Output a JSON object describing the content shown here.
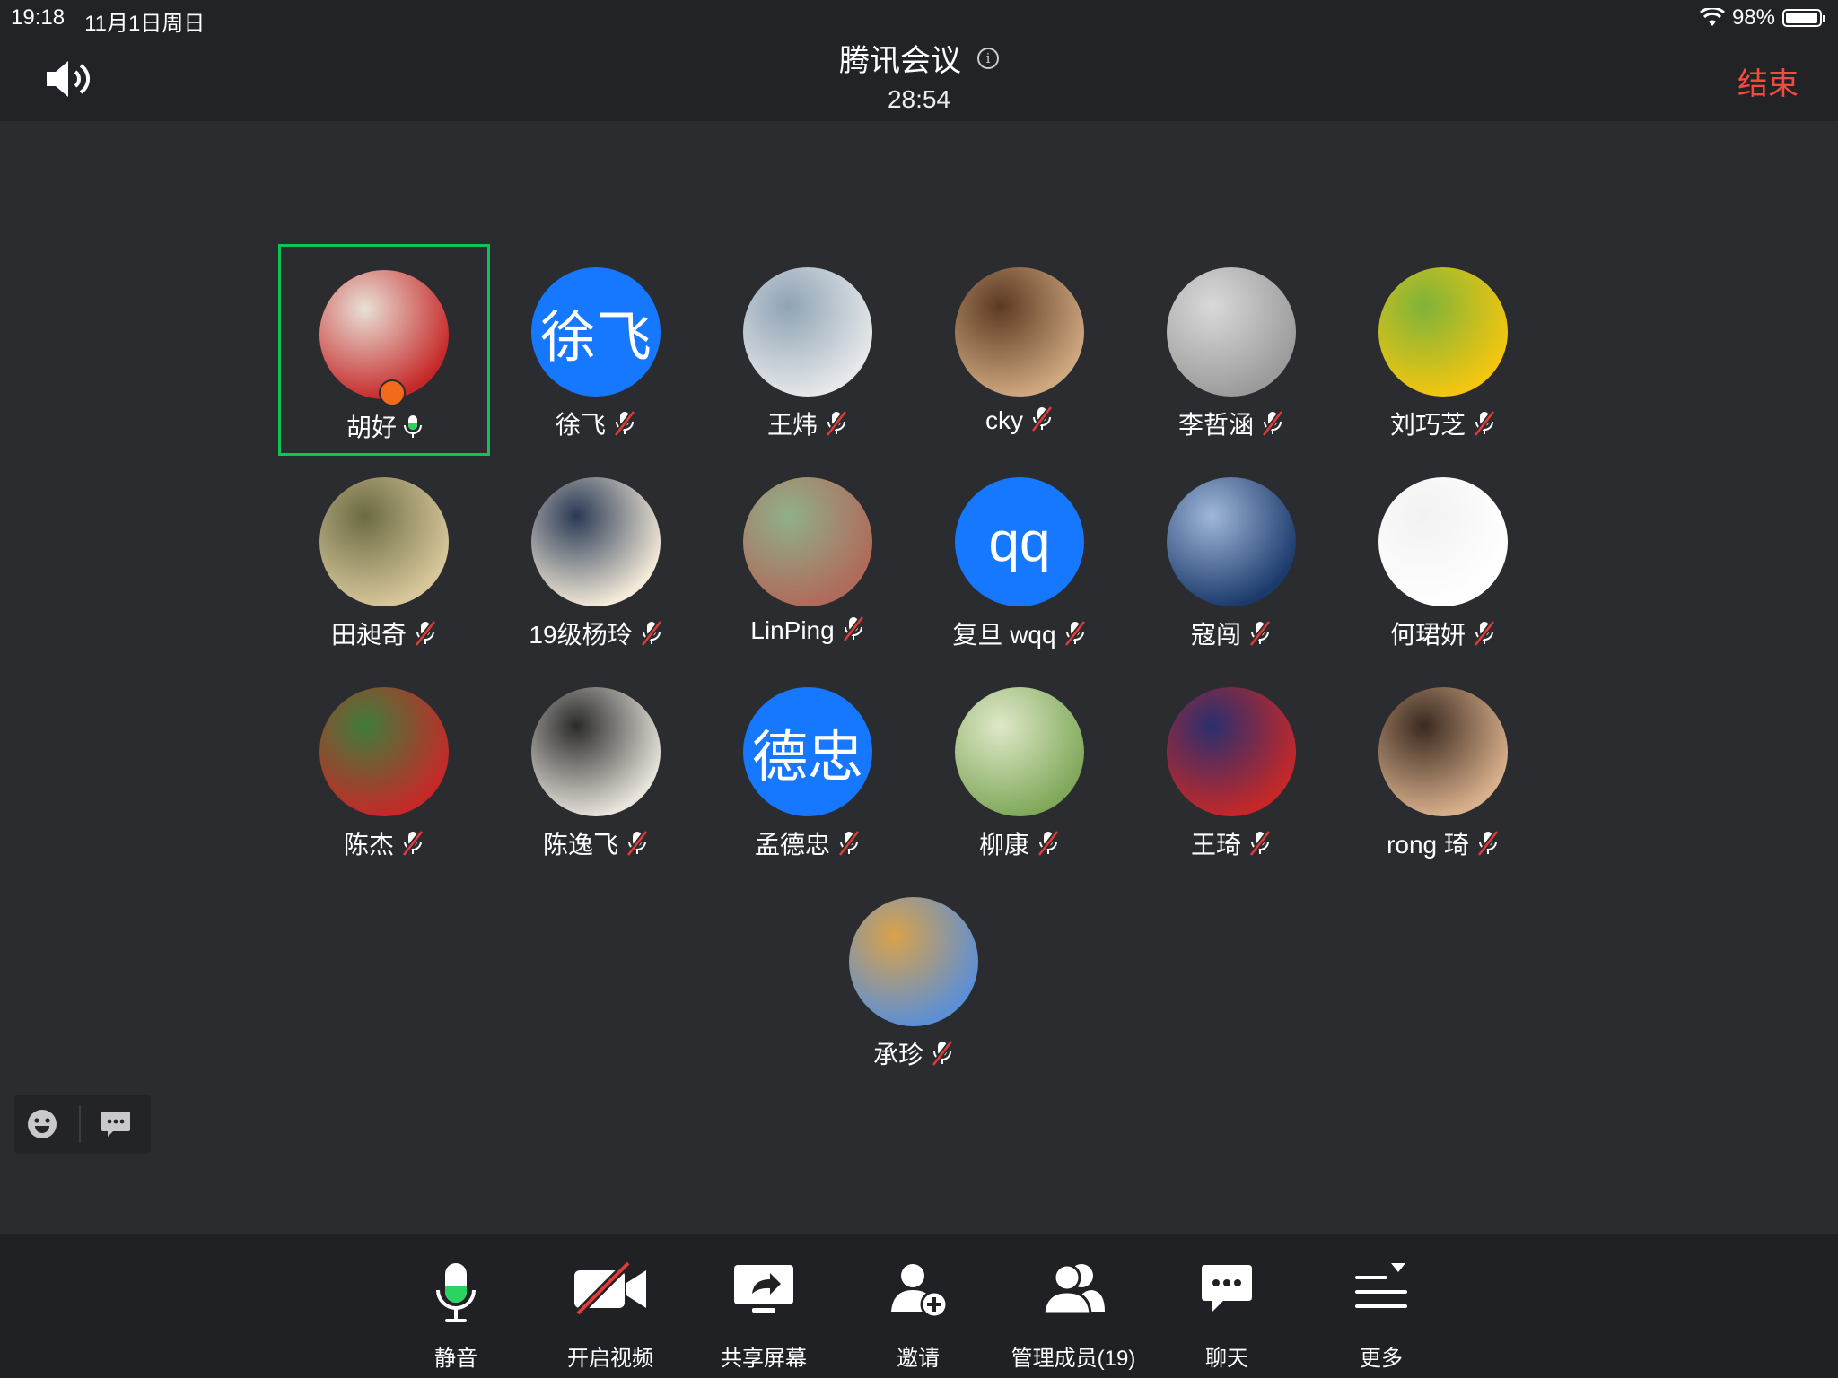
{
  "status_bar": {
    "time": "19:18",
    "date": "11月1日周日",
    "battery": "98%",
    "battery_level": 0.98
  },
  "header": {
    "title": "腾讯会议",
    "timer": "28:54",
    "end_label": "结束"
  },
  "participants": [
    {
      "name": "胡好",
      "mic": "on",
      "avatar": "photo",
      "host": true,
      "active": true,
      "colors": [
        "#c62828",
        "#e8e0d6"
      ]
    },
    {
      "name": "徐飞",
      "mic": "muted",
      "avatar": "text",
      "avatar_text": "徐飞"
    },
    {
      "name": "王炜",
      "mic": "muted",
      "avatar": "photo",
      "colors": [
        "#e6e8ea",
        "#8fa3b5"
      ]
    },
    {
      "name": "cky",
      "mic": "muted",
      "avatar": "photo",
      "colors": [
        "#cfa880",
        "#5c3a22"
      ]
    },
    {
      "name": "李哲涵",
      "mic": "muted",
      "avatar": "photo",
      "colors": [
        "#9b9b9b",
        "#d9d9d9"
      ]
    },
    {
      "name": "刘巧芝",
      "mic": "muted",
      "avatar": "photo",
      "colors": [
        "#f4c60f",
        "#7fb33a"
      ]
    },
    {
      "name": "田昶奇",
      "mic": "muted",
      "avatar": "photo",
      "colors": [
        "#d8c79a",
        "#6b6b45"
      ]
    },
    {
      "name": "19级杨玲",
      "mic": "muted",
      "avatar": "photo",
      "colors": [
        "#f3ead8",
        "#2a3a55"
      ]
    },
    {
      "name": "LinPing",
      "mic": "muted",
      "avatar": "photo",
      "colors": [
        "#b06a5a",
        "#8fb08a"
      ]
    },
    {
      "name": "复旦 wqq",
      "mic": "muted",
      "avatar": "text",
      "avatar_text": "qq"
    },
    {
      "name": "寇闯",
      "mic": "muted",
      "avatar": "photo",
      "colors": [
        "#1b3a6b",
        "#9fb7d9"
      ]
    },
    {
      "name": "何珺妍",
      "mic": "muted",
      "avatar": "photo",
      "colors": [
        "#ffffff",
        "#f2f2f2"
      ]
    },
    {
      "name": "陈杰",
      "mic": "muted",
      "avatar": "photo",
      "colors": [
        "#c62828",
        "#3f7d3a"
      ]
    },
    {
      "name": "陈逸飞",
      "mic": "muted",
      "avatar": "photo",
      "colors": [
        "#e8e4dc",
        "#2b2b2b"
      ]
    },
    {
      "name": "孟德忠",
      "mic": "muted",
      "avatar": "text",
      "avatar_text": "德忠"
    },
    {
      "name": "柳康",
      "mic": "muted",
      "avatar": "photo",
      "colors": [
        "#7fa85a",
        "#dfe8c8"
      ]
    },
    {
      "name": "王琦",
      "mic": "muted",
      "avatar": "photo",
      "colors": [
        "#c62828",
        "#2a2f6e"
      ]
    },
    {
      "name": "rong 琦",
      "mic": "muted",
      "avatar": "photo",
      "colors": [
        "#d9b08c",
        "#3b2a20"
      ]
    },
    {
      "name": "承珍",
      "mic": "muted",
      "avatar": "photo",
      "colors": [
        "#5b8fd6",
        "#d9a24a"
      ]
    }
  ],
  "float_bar": {
    "items": [
      {
        "icon": "emoji-icon"
      },
      {
        "icon": "chat-bubble-icon"
      }
    ]
  },
  "toolbar": {
    "items": [
      {
        "key": "mute",
        "label": "静音",
        "icon": "microphone-icon"
      },
      {
        "key": "video",
        "label": "开启视频",
        "icon": "video-off-icon"
      },
      {
        "key": "share",
        "label": "共享屏幕",
        "icon": "share-screen-icon"
      },
      {
        "key": "invite",
        "label": "邀请",
        "icon": "add-person-icon"
      },
      {
        "key": "members",
        "label": "管理成员(19)",
        "icon": "members-icon"
      },
      {
        "key": "chat",
        "label": "聊天",
        "icon": "chat-icon"
      },
      {
        "key": "more",
        "label": "更多",
        "icon": "more-menu-icon"
      }
    ]
  },
  "colors": {
    "accent_blue": "#1677ff",
    "end_red": "#f44b3e",
    "mic_green": "#2bd460",
    "mute_red": "#e53935",
    "active_border": "#11c257"
  }
}
